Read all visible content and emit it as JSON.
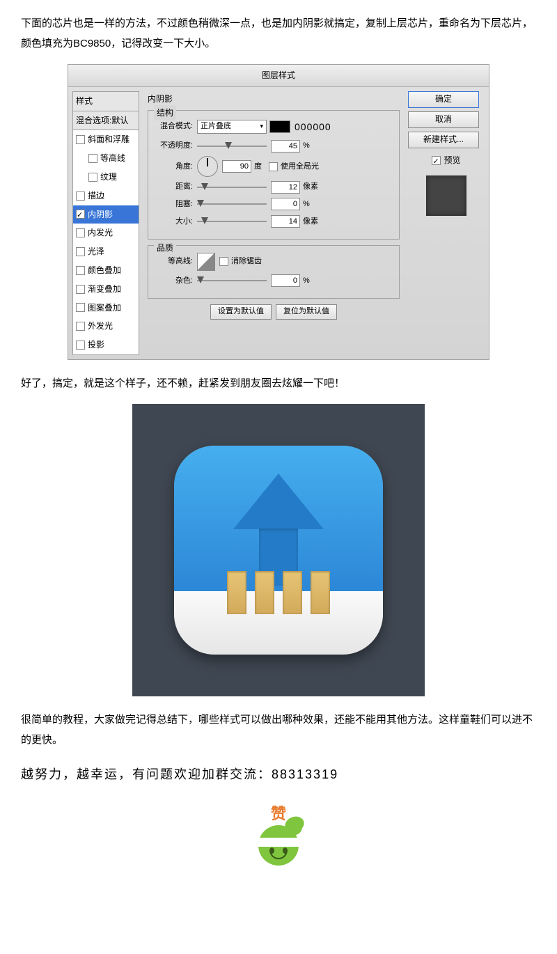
{
  "intro": "下面的芯片也是一样的方法，不过颜色稍微深一点，也是加内阴影就搞定，复制上层芯片，重命名为下层芯片，颜色填充为BC9850，记得改变一下大小。",
  "dialog": {
    "title": "图层样式",
    "styles_header": "样式",
    "blending_options": "混合选项:默认",
    "items": {
      "bevel": "斜面和浮雕",
      "contour": "等高线",
      "texture": "纹理",
      "stroke": "描边",
      "inner_shadow": "内阴影",
      "inner_glow": "内发光",
      "satin": "光泽",
      "color_overlay": "颜色叠加",
      "gradient_overlay": "渐变叠加",
      "pattern_overlay": "图案叠加",
      "outer_glow": "外发光",
      "drop_shadow": "投影"
    },
    "panel": {
      "title": "内阴影",
      "structure": "结构",
      "blend_mode": "混合模式:",
      "blend_mode_value": "正片叠底",
      "color_hex": "000000",
      "opacity": "不透明度:",
      "opacity_value": "45",
      "percent": "%",
      "angle": "角度:",
      "angle_value": "90",
      "degree": "度",
      "global_light": "使用全局光",
      "distance": "距离:",
      "distance_value": "12",
      "px": "像素",
      "choke": "阻塞:",
      "choke_value": "0",
      "size": "大小:",
      "size_value": "14",
      "quality": "品质",
      "contour_label": "等高线:",
      "antialias": "消除锯齿",
      "noise": "杂色:",
      "noise_value": "0",
      "set_default": "设置为默认值",
      "reset_default": "复位为默认值"
    },
    "buttons": {
      "ok": "确定",
      "cancel": "取消",
      "new_style": "新建样式...",
      "preview": "预览"
    }
  },
  "done": "好了，搞定，就是这个样子，还不赖，赶紧发到朋友圈去炫耀一下吧！",
  "summary": "很简单的教程，大家做完记得总结下，哪些样式可以做出哪种效果，还能不能用其他方法。这样童鞋们可以进不的更快。",
  "footer": "越努力，越幸运，有问题欢迎加群交流：88313319",
  "zan": "赞"
}
